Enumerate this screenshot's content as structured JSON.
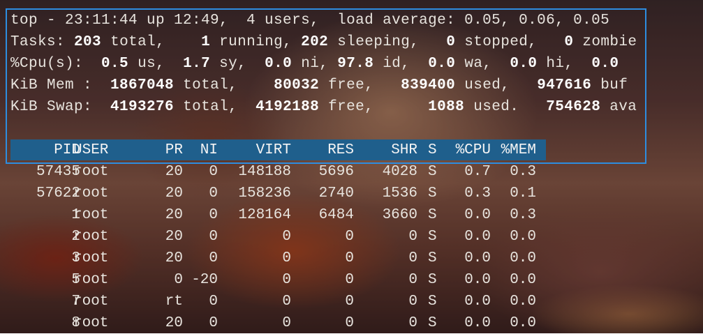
{
  "summary": {
    "line1": "top - 23:11:44 up 12:49,  4 users,  load average: 0.05, 0.06, 0.05",
    "tasks": {
      "label": "Tasks:",
      "total": "203",
      "total_label": "total,",
      "running": "1",
      "running_label": "running,",
      "sleeping": "202",
      "sleeping_label": "sleeping,",
      "stopped": "0",
      "stopped_label": "stopped,",
      "zombie": "0",
      "zombie_label": "zombie"
    },
    "cpu": {
      "label": "%Cpu(s):",
      "us": "0.5",
      "us_label": "us,",
      "sy": "1.7",
      "sy_label": "sy,",
      "ni": "0.0",
      "ni_label": "ni,",
      "id": "97.8",
      "id_label": "id,",
      "wa": "0.0",
      "wa_label": "wa,",
      "hi": "0.0",
      "hi_label": "hi,",
      "si": "0.0"
    },
    "mem": {
      "label": "KiB Mem :",
      "total": "1867048",
      "total_label": "total,",
      "free": "80032",
      "free_label": "free,",
      "used": "839400",
      "used_label": "used,",
      "buf": "947616",
      "buf_label": "buf"
    },
    "swap": {
      "label": "KiB Swap:",
      "total": "4193276",
      "total_label": "total,",
      "free": "4192188",
      "free_label": "free,",
      "used": "1088",
      "used_label": "used.",
      "avail": "754628",
      "avail_label": "ava"
    }
  },
  "table": {
    "columns": [
      "PID",
      "USER",
      "PR",
      "NI",
      "VIRT",
      "RES",
      "SHR",
      "S",
      "%CPU",
      "%MEM"
    ],
    "rows": [
      [
        "57435",
        "root",
        "20",
        "0",
        "148188",
        "5696",
        "4028",
        "S",
        "0.7",
        "0.3"
      ],
      [
        "57622",
        "root",
        "20",
        "0",
        "158236",
        "2740",
        "1536",
        "S",
        "0.3",
        "0.1"
      ],
      [
        "1",
        "root",
        "20",
        "0",
        "128164",
        "6484",
        "3660",
        "S",
        "0.0",
        "0.3"
      ],
      [
        "2",
        "root",
        "20",
        "0",
        "0",
        "0",
        "0",
        "S",
        "0.0",
        "0.0"
      ],
      [
        "3",
        "root",
        "20",
        "0",
        "0",
        "0",
        "0",
        "S",
        "0.0",
        "0.0"
      ],
      [
        "5",
        "root",
        "0",
        "-20",
        "0",
        "0",
        "0",
        "S",
        "0.0",
        "0.0"
      ],
      [
        "7",
        "root",
        "rt",
        "0",
        "0",
        "0",
        "0",
        "S",
        "0.0",
        "0.0"
      ],
      [
        "8",
        "root",
        "20",
        "0",
        "0",
        "0",
        "0",
        "S",
        "0.0",
        "0.0"
      ]
    ]
  },
  "colors": {
    "highlight_border": "#2d8de0",
    "header_bar": "#1f5f8c",
    "text": "#e8e4de"
  }
}
